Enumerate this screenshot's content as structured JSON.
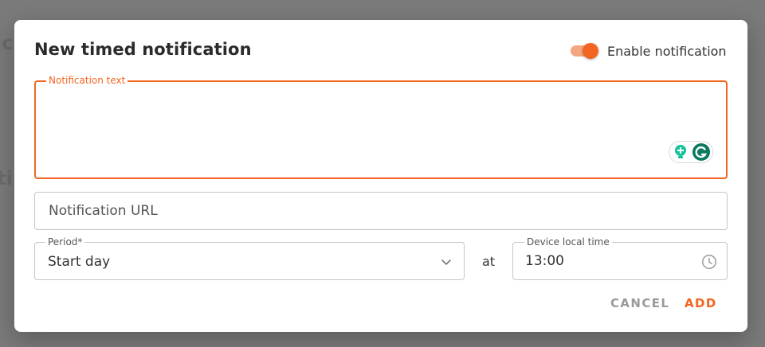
{
  "dialog": {
    "title": "New timed notification",
    "enable_toggle": {
      "label": "Enable notification",
      "checked": true
    },
    "notification_text": {
      "label": "Notification text",
      "value": ""
    },
    "notification_url": {
      "placeholder": "Notification URL",
      "value": ""
    },
    "period": {
      "label": "Period*",
      "selected": "Start day"
    },
    "at_label": "at",
    "device_time": {
      "label": "Device local time",
      "value": "13:00"
    },
    "actions": {
      "cancel_label": "CANCEL",
      "add_label": "ADD"
    }
  },
  "icons": {
    "toggle": "toggle-switch",
    "grammarly": "grammarly-icon",
    "chevron": "chevron-down-icon",
    "clock": "clock-icon"
  },
  "colors": {
    "accent": "#f26522",
    "accent_light": "#f4a77f",
    "overlay": "#7a7a7a",
    "grammarly_green": "#15c39a",
    "grammarly_dark": "#0b7a5e"
  }
}
